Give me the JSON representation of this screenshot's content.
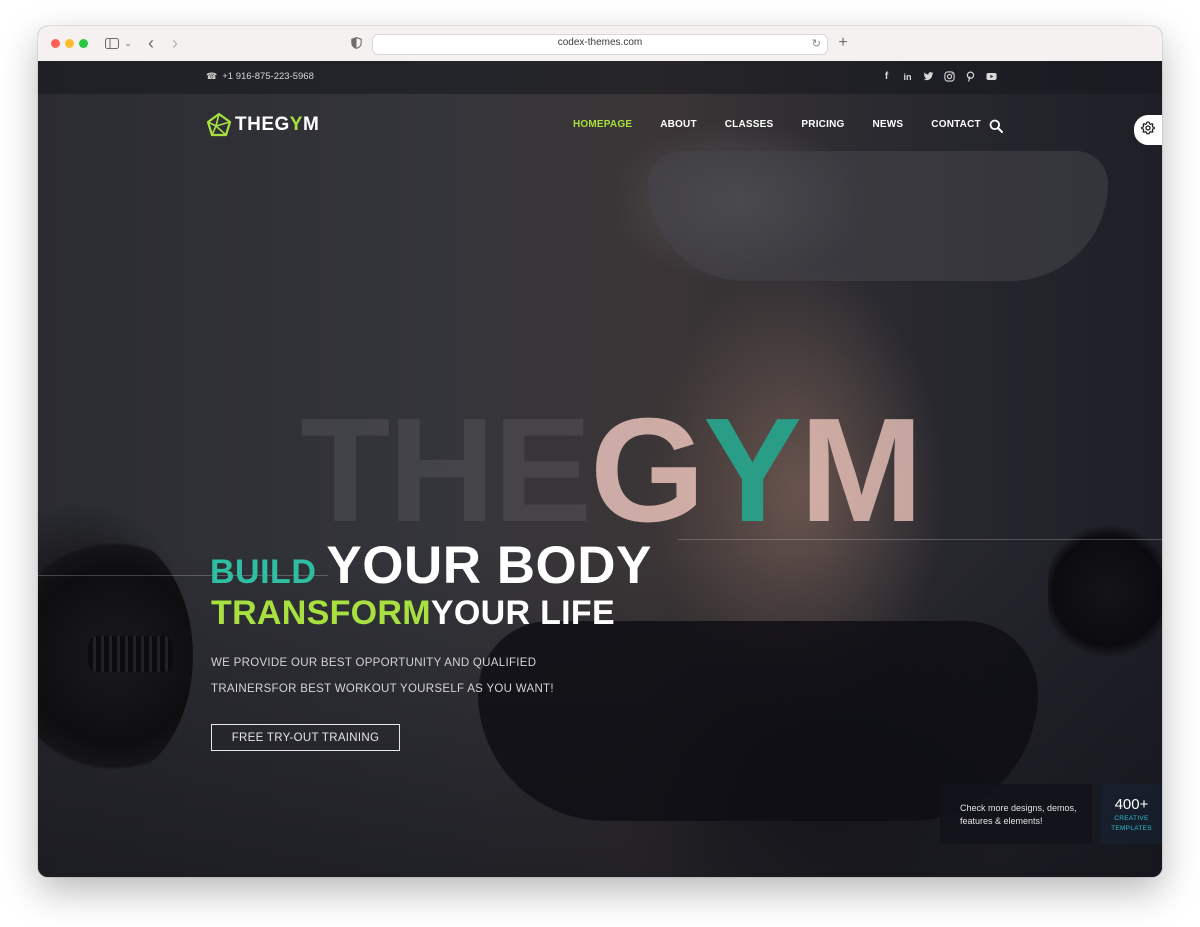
{
  "browser": {
    "url": "codex-themes.com"
  },
  "topbar": {
    "phone": "+1 916-875-223-5968",
    "social_icons": [
      "facebook-icon",
      "linkedin-icon",
      "twitter-icon",
      "instagram-icon",
      "pinterest-icon",
      "youtube-icon"
    ]
  },
  "logo": {
    "prefix": "THEG",
    "accent": "Y",
    "suffix": "M"
  },
  "nav": {
    "items": [
      "HOMEPAGE",
      "ABOUT",
      "CLASSES",
      "PRICING",
      "NEWS",
      "CONTACT"
    ],
    "active": "HOMEPAGE"
  },
  "hero": {
    "watermark_prefix": "THE",
    "watermark_g": "G",
    "watermark_y": "Y",
    "watermark_m": "M",
    "line1_accent": "BUILD",
    "line1_main": "YOUR BODY",
    "line2_accent": "TRANSFORM",
    "line2_main": "YOUR LIFE",
    "desc_line1": "WE PROVIDE OUR BEST OPPORTUNITY AND QUALIFIED",
    "desc_line2": "TRAINERSFOR BEST WORKOUT YOURSELF AS YOU WANT!",
    "cta": "FREE TRY-OUT TRAINING"
  },
  "promo": {
    "line1": "Check more designs, demos,",
    "line2": "features & elements!",
    "count": "400+",
    "sub1": "CREATIVE",
    "sub2": "TEMPLATES"
  },
  "colors": {
    "accent_green": "#a8e03f",
    "accent_teal": "#2ebfa2",
    "background": "#1d1f27"
  }
}
